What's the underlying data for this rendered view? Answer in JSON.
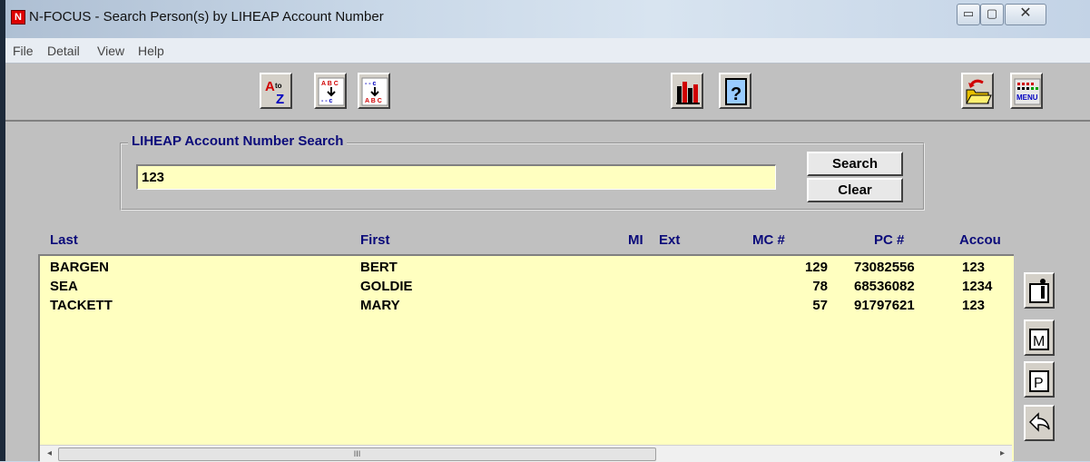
{
  "window": {
    "icon_letter": "N",
    "title": "N-FOCUS - Search Person(s) by LIHEAP Account Number",
    "min_glyph": "▭",
    "max_glyph": "▢",
    "close_glyph": "✕"
  },
  "menu": [
    "File",
    "Detail",
    "View",
    "Help"
  ],
  "toolbar": {
    "icons": [
      "sort-a-to-z-icon",
      "sort-ascending-icon",
      "sort-descending-icon",
      "chart-icon",
      "help-icon",
      "open-folder-icon",
      "menu-icon"
    ],
    "menu_icon_label": "MENU"
  },
  "search": {
    "group_label": "LIHEAP Account Number Search",
    "value": "123",
    "search_button": "Search",
    "clear_button": "Clear"
  },
  "columns": {
    "last": "Last",
    "first": "First",
    "mi": "MI",
    "ext": "Ext",
    "mc": "MC #",
    "pc": "PC #",
    "account": "Accou"
  },
  "rows": [
    {
      "last": "BARGEN",
      "first": "BERT",
      "mi": "",
      "ext": "",
      "mc": "129",
      "pc": "73082556",
      "account": "123"
    },
    {
      "last": "SEA",
      "first": "GOLDIE",
      "mi": "",
      "ext": "",
      "mc": "78",
      "pc": "68536082",
      "account": "1234"
    },
    {
      "last": "TACKETT",
      "first": "MARY",
      "mi": "",
      "ext": "",
      "mc": "57",
      "pc": "91797621",
      "account": "123"
    }
  ],
  "scrollbar": {
    "left_arrow": "◂",
    "right_arrow": "▸",
    "grip": "III"
  },
  "side_buttons": {
    "icons": [
      "person-info-icon",
      "letter-m-icon",
      "letter-p-icon",
      "back-arrow-icon"
    ],
    "m_label": "M",
    "p_label": "P"
  }
}
